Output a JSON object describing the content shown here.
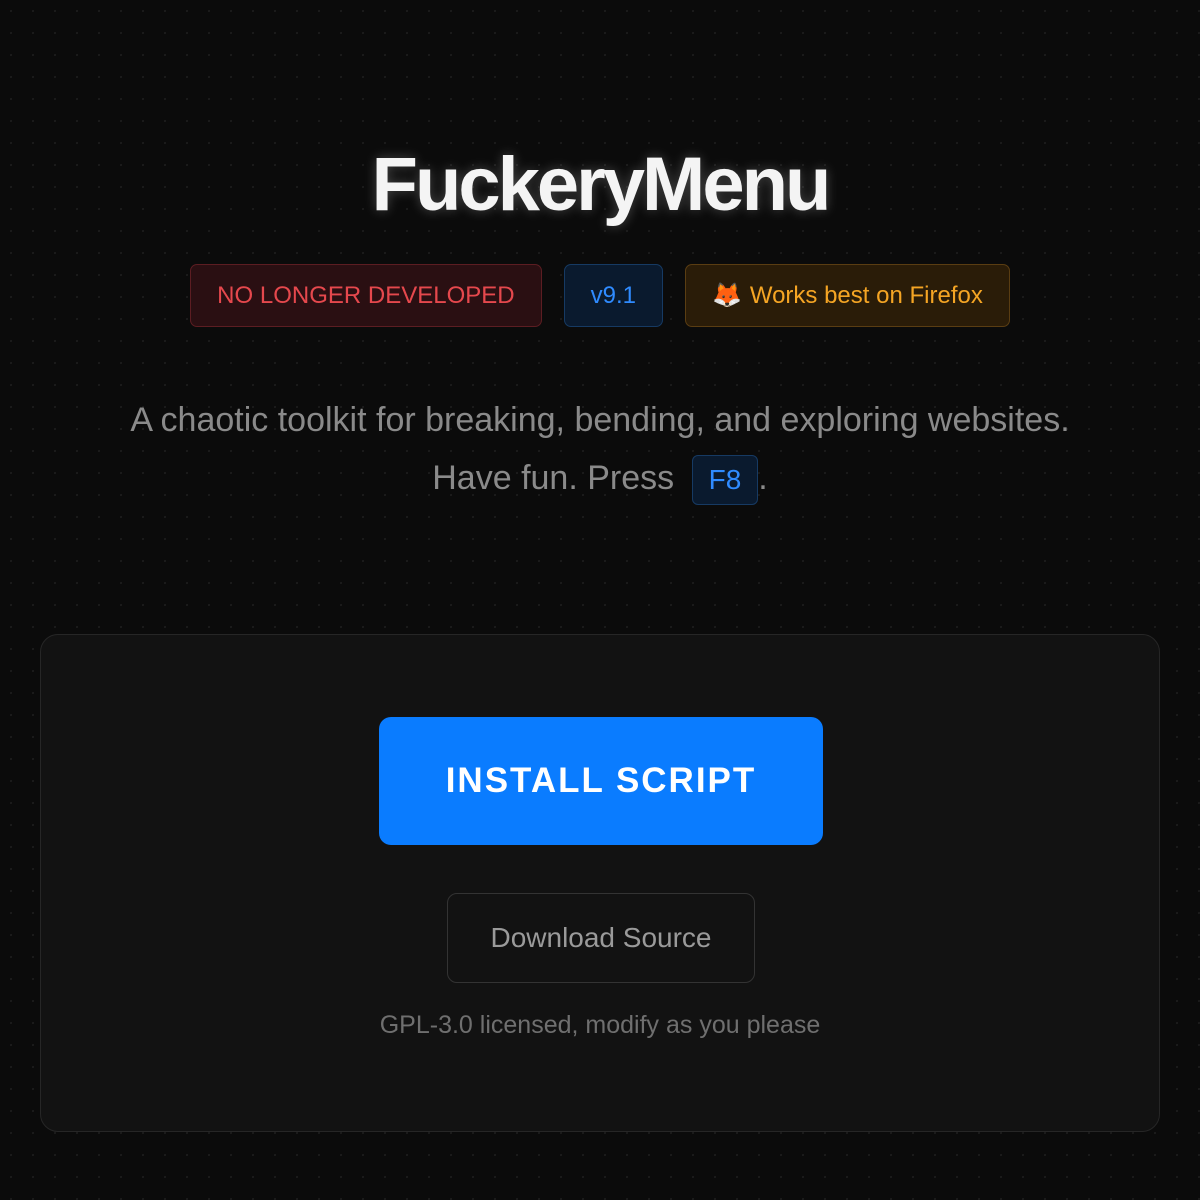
{
  "header": {
    "title": "FuckeryMenu"
  },
  "badges": {
    "status": "NO LONGER DEVELOPED",
    "version": "v9.1",
    "browser_icon": "fox-icon",
    "browser": "Works best on Firefox"
  },
  "description": {
    "line1": "A chaotic toolkit for breaking, bending, and exploring websites.",
    "line2_prefix": "Have fun. Press",
    "hotkey": "F8",
    "line2_suffix": "."
  },
  "card": {
    "install_label": "INSTALL SCRIPT",
    "download_label": "Download Source",
    "license_text": "GPL-3.0 licensed, modify as you please"
  },
  "colors": {
    "background": "#0b0b0b",
    "accent_blue": "#0a7cff",
    "status_red": "#e5484d",
    "warning_orange": "#f5a524"
  }
}
